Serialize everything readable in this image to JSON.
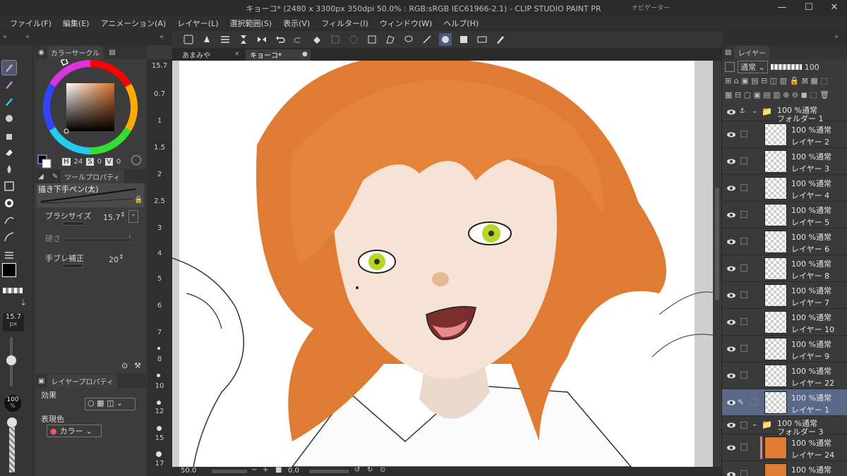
{
  "window": {
    "title": "キョーコ* (2480 x 3300px 350dpi 50.0% : RGB:sRGB IEC61966-2.1) - CLIP STUDIO PAINT PR",
    "navigator_label": "ナビゲーター",
    "minimize": "—",
    "maximize": "☐",
    "close": "✕"
  },
  "menu": [
    "ファイル(F)",
    "編集(E)",
    "アニメーション(A)",
    "レイヤー(L)",
    "選択範囲(S)",
    "表示(V)",
    "フィルター(I)",
    "ウィンドウ(W)",
    "ヘルプ(H)"
  ],
  "color_panel": {
    "tab_label": "カラーサークル",
    "h_label": "H",
    "h_value": "24",
    "s_label": "S",
    "s_value": "0",
    "v_label": "V",
    "v_value": "0",
    "hue_color": "#d96f2a"
  },
  "tool_property": {
    "tab_label": "ツールプロパティ",
    "brush_name": "描き下手ペン(太)",
    "brush_size_label": "ブラシサイズ",
    "brush_size_value": "15.7",
    "hardness_label": "硬さ",
    "stabilization_label": "手ブレ補正",
    "stabilization_value": "20"
  },
  "layer_property": {
    "tab_label": "レイヤープロパティ",
    "effect_label": "効果",
    "expression_label": "表現色",
    "expression_value": "カラー"
  },
  "left_tools": {
    "brush_size_value": "15.7",
    "brush_size_unit": "px",
    "opacity_value": "100",
    "opacity_unit": "%"
  },
  "ruler": {
    "top_value": "15.7",
    "ticks": [
      "0.7",
      "1",
      "1.5",
      "2",
      "2.5",
      "3",
      "4",
      "5",
      "6",
      "7",
      "8",
      "10",
      "12",
      "15",
      "17"
    ]
  },
  "tabs": [
    {
      "label": "あまみや",
      "active": false
    },
    {
      "label": "キョーコ*",
      "active": true
    }
  ],
  "statusbar": {
    "zoom": "50.0",
    "angle": "0.0"
  },
  "layers_panel": {
    "tab_label": "レイヤー",
    "blend_mode": "通常",
    "opacity": "100",
    "rows": [
      {
        "type": "folder",
        "blend": "100 %通常",
        "name": "フォルダー 1"
      },
      {
        "type": "layer",
        "blend": "100 %通常",
        "name": "レイヤー 2"
      },
      {
        "type": "layer",
        "blend": "100 %通常",
        "name": "レイヤー 3"
      },
      {
        "type": "layer",
        "blend": "100 %通常",
        "name": "レイヤー 4"
      },
      {
        "type": "layer",
        "blend": "100 %通常",
        "name": "レイヤー 5"
      },
      {
        "type": "layer",
        "blend": "100 %通常",
        "name": "レイヤー 6"
      },
      {
        "type": "layer",
        "blend": "100 %通常",
        "name": "レイヤー 8"
      },
      {
        "type": "layer",
        "blend": "100 %通常",
        "name": "レイヤー 7"
      },
      {
        "type": "layer",
        "blend": "100 %通常",
        "name": "レイヤー 10"
      },
      {
        "type": "layer",
        "blend": "100 %通常",
        "name": "レイヤー 9"
      },
      {
        "type": "layer",
        "blend": "100 %通常",
        "name": "レイヤー 22"
      },
      {
        "type": "layer",
        "blend": "100 %通常",
        "name": "レイヤー 1",
        "selected": true
      },
      {
        "type": "folder",
        "blend": "100 %通常",
        "name": "フォルダー 3"
      },
      {
        "type": "layer",
        "blend": "100 %通常",
        "name": "レイヤー 24"
      },
      {
        "type": "layer",
        "blend": "100 %通常",
        "name": ""
      }
    ]
  },
  "colors": {
    "hair": "#e07b33",
    "skin": "#f6e3d6",
    "eye": "#b8d62a",
    "selection": "#5a6888"
  }
}
